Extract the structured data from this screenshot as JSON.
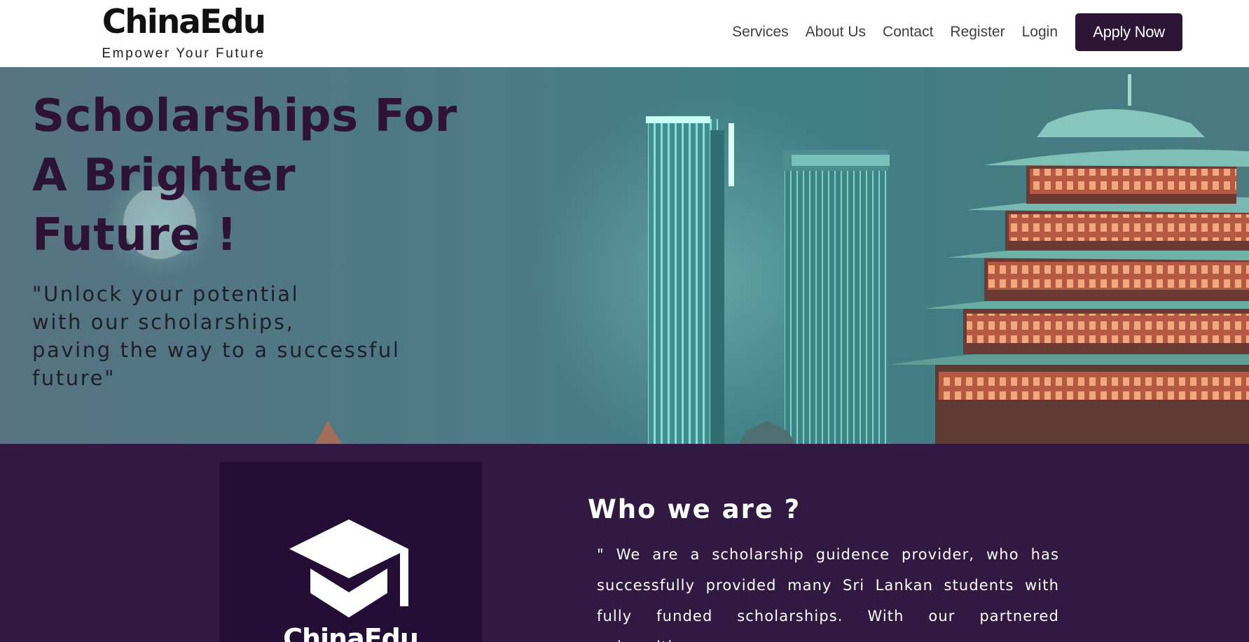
{
  "header": {
    "brand_name": "ChinaEdu",
    "brand_tagline": "Empower Your Future",
    "nav": [
      {
        "label": "Services"
      },
      {
        "label": "About Us"
      },
      {
        "label": "Contact"
      },
      {
        "label": "Register"
      },
      {
        "label": "Login"
      }
    ],
    "cta_label": "Apply Now"
  },
  "hero": {
    "title": "Scholarships For A Brighter Future !",
    "quote": "\"Unlock your potential\nwith our scholarships,\npaving the way to a successful\nfuture\""
  },
  "about": {
    "logo_text": "ChinaEdu",
    "heading": "Who we are ?",
    "text": "\" We are a scholarship guidence provider, who has successfully provided many Sri Lankan students with fully funded scholarships. With our partnered universities,"
  },
  "colors": {
    "brand_dark": "#2d1538",
    "about_bg": "#311941",
    "logo_bg": "#250e35",
    "hero_title": "#2d1437"
  },
  "icons": {
    "logo": "graduation-cap-icon"
  }
}
